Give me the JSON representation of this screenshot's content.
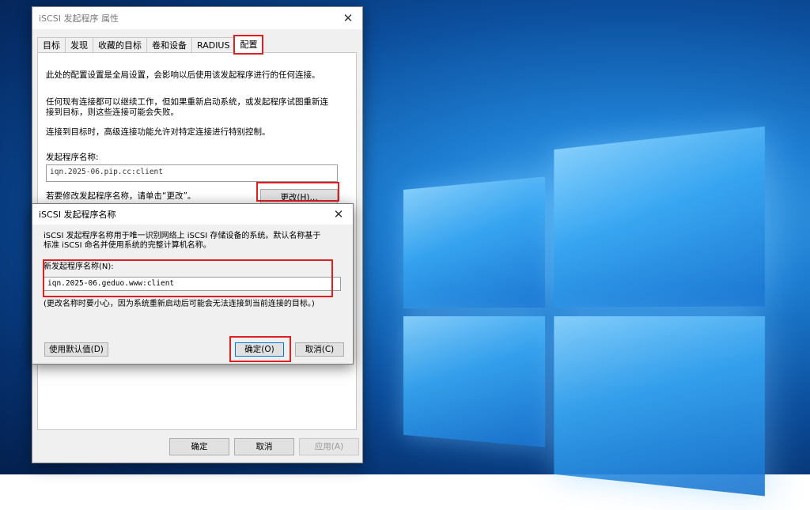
{
  "main_window": {
    "title": "iSCSI 发起程序 属性",
    "tabs": [
      {
        "label": "目标"
      },
      {
        "label": "发现"
      },
      {
        "label": "收藏的目标"
      },
      {
        "label": "卷和设备"
      },
      {
        "label": "RADIUS"
      },
      {
        "label": "配置",
        "active": true
      }
    ],
    "config": {
      "intro": "此处的配置设置是全局设置，会影响以后使用该发起程序进行的任何连接。",
      "warning_line1": "任何现有连接都可以继续工作，但如果重新启动系统，或发起程序试图重新连",
      "warning_line2": "接到目标，则这些连接可能会失败。",
      "advanced": "连接到目标时，高级连接功能允许对特定连接进行特别控制。",
      "initiator_label": "发起程序名称:",
      "initiator_value": "iqn.2025-06.pip.cc:client",
      "change_hint": "若要修改发起程序名称，请单击“更改”。",
      "change_button": "更改(H)..."
    },
    "footer": {
      "ok": "确定",
      "cancel": "取消",
      "apply": "应用(A)"
    }
  },
  "dialog": {
    "title": "iSCSI 发起程序名称",
    "desc_line1": "iSCSI 发起程序名称用于唯一识别网络上 iSCSI 存储设备的系统。默认名称基于",
    "desc_line2": "标准 iSCSI 命名并使用系统的完整计算机名称。",
    "new_name_label": "新发起程序名称(N):",
    "new_name_value": "iqn.2025-06.geduo.www:client",
    "caution": "(更改名称时要小心，因为系统重新启动后可能会无法连接到当前连接的目标。)",
    "default_button": "使用默认值(D)",
    "ok_button": "确定(O)",
    "cancel_button": "取消(C)"
  },
  "colors": {
    "highlight": "#e02020",
    "desktop_accent": "#1e7fd3"
  }
}
